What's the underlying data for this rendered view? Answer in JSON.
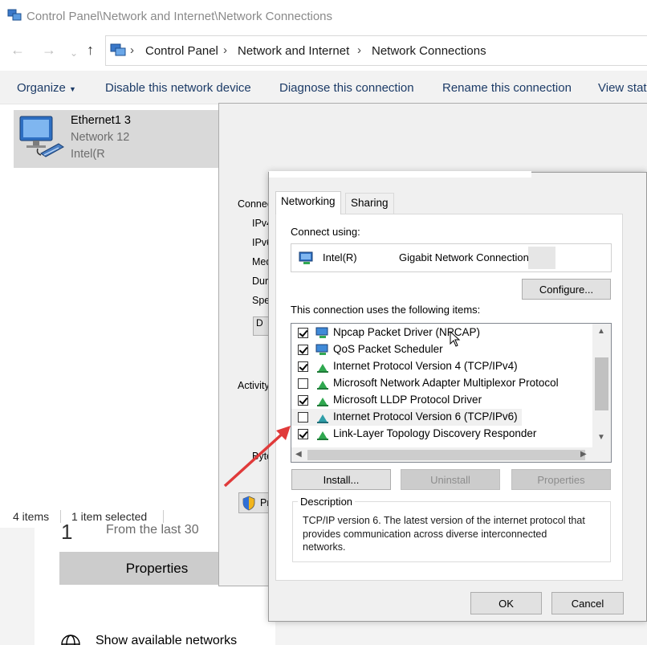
{
  "explorer": {
    "title": "Control Panel\\Network and Internet\\Network Connections",
    "breadcrumb": [
      "Control Panel",
      "Network and Internet",
      "Network Connections"
    ],
    "commands": [
      "Organize",
      "Disable this network device",
      "Diagnose this connection",
      "Rename this connection",
      "View stat"
    ],
    "connection": {
      "name": "Ethernet1 3",
      "network": "Network 12",
      "device": "Intel(R"
    },
    "status": {
      "items": "4 items",
      "selected": "1 item selected"
    }
  },
  "settings": {
    "number": "1",
    "subtitle": "From the last 30",
    "properties_button": "Properties",
    "show_networks": "Show available networks"
  },
  "status_dialog": {
    "connection_label": "Connec",
    "labels": [
      "IPv4",
      "IPv6",
      "Med",
      "Dura",
      "Spe"
    ],
    "d_button": "D",
    "activity_label": "Activity",
    "bytes_label": "Byte",
    "pr_button": "Pr"
  },
  "properties_dialog": {
    "tabs": [
      "Networking",
      "Sharing"
    ],
    "connect_using_label": "Connect using:",
    "adapter": [
      "Intel(R)",
      "Gigabit Network Connection"
    ],
    "configure_button": "Configure...",
    "items_label": "This connection uses the following items:",
    "items": [
      {
        "label": "Npcap Packet Driver (NPCAP)",
        "checked": true,
        "icon": "network-client-icon"
      },
      {
        "label": "QoS Packet Scheduler",
        "checked": true,
        "icon": "network-client-icon"
      },
      {
        "label": "Internet Protocol Version 4 (TCP/IPv4)",
        "checked": true,
        "icon": "protocol-icon"
      },
      {
        "label": "Microsoft Network Adapter Multiplexor Protocol",
        "checked": false,
        "icon": "protocol-icon"
      },
      {
        "label": "Microsoft LLDP Protocol Driver",
        "checked": true,
        "icon": "protocol-icon"
      },
      {
        "label": "Internet Protocol Version 6 (TCP/IPv6)",
        "checked": false,
        "icon": "protocol-icon",
        "selected": true
      },
      {
        "label": "Link-Layer Topology Discovery Responder",
        "checked": true,
        "icon": "protocol-icon"
      }
    ],
    "install_button": "Install...",
    "uninstall_button": "Uninstall",
    "properties_button": "Properties",
    "description_label": "Description",
    "description_text": "TCP/IP version 6. The latest version of the internet protocol that provides communication across diverse interconnected networks.",
    "ok_button": "OK",
    "cancel_button": "Cancel"
  },
  "colors": {
    "annotation_arrow": "#e03a3a",
    "selection": "#d9d9d9",
    "command_text": "#1c3b67"
  }
}
